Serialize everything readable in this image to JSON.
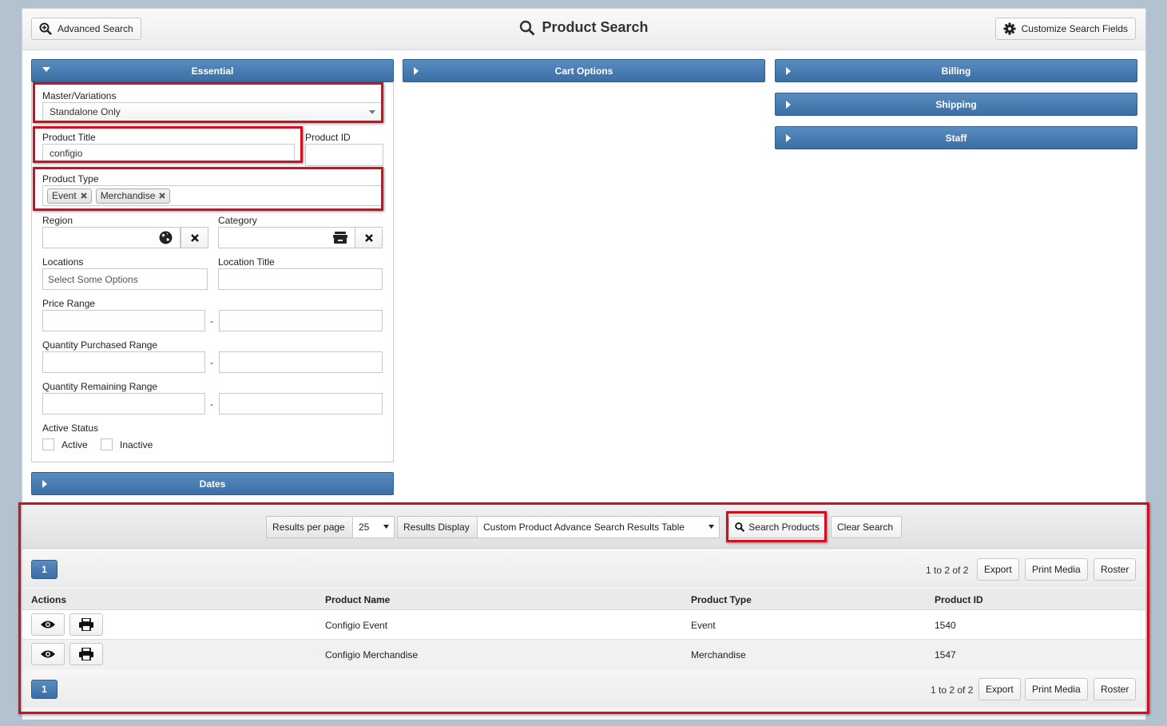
{
  "header": {
    "title": "Product Search",
    "advanced_search_label": "Advanced Search",
    "customize_label": "Customize Search Fields"
  },
  "sections": {
    "essential": "Essential",
    "cart_options": "Cart Options",
    "billing": "Billing",
    "shipping": "Shipping",
    "staff": "Staff",
    "dates": "Dates"
  },
  "form": {
    "master_variations_label": "Master/Variations",
    "master_variations_value": "Standalone Only",
    "product_title_label": "Product Title",
    "product_title_value": "configio",
    "product_id_label": "Product ID",
    "product_type_label": "Product Type",
    "product_type_tags": [
      "Event",
      "Merchandise"
    ],
    "region_label": "Region",
    "category_label": "Category",
    "locations_label": "Locations",
    "locations_placeholder": "Select Some Options",
    "location_title_label": "Location Title",
    "price_range_label": "Price Range",
    "qty_purchased_label": "Quantity Purchased Range",
    "qty_remaining_label": "Quantity Remaining Range",
    "range_separator": "-",
    "active_status_label": "Active Status",
    "active_label": "Active",
    "inactive_label": "Inactive"
  },
  "toolbar": {
    "results_per_page_label": "Results per page",
    "results_per_page_value": "25",
    "results_display_label": "Results Display",
    "results_display_value": "Custom Product Advance Search Results Table",
    "search_products_label": "Search Products",
    "clear_search_label": "Clear Search"
  },
  "pager": {
    "page": "1",
    "count_top": "1 to 2 of 2",
    "count_bottom": "1 to 2 of 2",
    "export_label": "Export",
    "print_media_label": "Print Media",
    "roster_label": "Roster"
  },
  "table": {
    "columns": [
      "Actions",
      "Product Name",
      "Product Type",
      "Product ID"
    ],
    "rows": [
      {
        "name": "Configio Event",
        "type": "Event",
        "id": "1540"
      },
      {
        "name": "Configio Merchandise",
        "type": "Merchandise",
        "id": "1547"
      }
    ]
  },
  "colors": {
    "accent_blue": "#3a6ea5",
    "highlight_red": "#d0101e",
    "background": "#b4c2d0"
  }
}
